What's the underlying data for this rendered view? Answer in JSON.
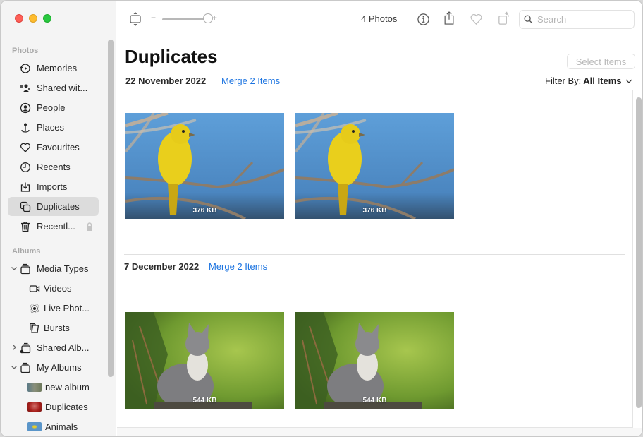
{
  "window": {
    "traffic_lights": [
      "close",
      "minimize",
      "zoom"
    ]
  },
  "sidebar": {
    "sections": [
      {
        "label": "Photos",
        "items": [
          {
            "label": "Memories",
            "icon": "memories-icon"
          },
          {
            "label": "Shared wit...",
            "icon": "shared-with-you-icon"
          },
          {
            "label": "People",
            "icon": "people-icon"
          },
          {
            "label": "Places",
            "icon": "places-icon"
          },
          {
            "label": "Favourites",
            "icon": "heart-icon"
          },
          {
            "label": "Recents",
            "icon": "clock-icon"
          },
          {
            "label": "Imports",
            "icon": "import-icon"
          },
          {
            "label": "Duplicates",
            "icon": "duplicates-icon",
            "selected": true
          },
          {
            "label": "Recentl...",
            "icon": "trash-icon",
            "locked": true
          }
        ]
      },
      {
        "label": "Albums",
        "items": [
          {
            "label": "Media Types",
            "icon": "album-stack-icon",
            "expanded": true
          },
          {
            "label": "Videos",
            "icon": "video-icon"
          },
          {
            "label": "Live Phot...",
            "icon": "live-photo-icon"
          },
          {
            "label": "Bursts",
            "icon": "bursts-icon"
          },
          {
            "label": "Shared Alb...",
            "icon": "shared-album-icon",
            "expanded": false
          },
          {
            "label": "My Albums",
            "icon": "album-stack-icon",
            "expanded": true
          },
          {
            "label": "new album",
            "thumb_color": "#6b7d6a"
          },
          {
            "label": "Duplicates",
            "thumb_color": "#a8201c"
          },
          {
            "label": "Animals",
            "thumb_color": "#5a95c9"
          }
        ]
      }
    ]
  },
  "toolbar": {
    "zoom_minus": "−",
    "zoom_plus": "+",
    "zoom_level": 0.85,
    "photo_count": "4 Photos",
    "search_placeholder": "Search"
  },
  "main": {
    "title": "Duplicates",
    "select_items_label": "Select Items",
    "filter_prefix": "Filter By:",
    "filter_value": "All Items",
    "groups": [
      {
        "date": "22 November 2022",
        "merge_label": "Merge 2 Items",
        "photos": [
          {
            "subject": "yellow bird on branch",
            "size": "376 KB"
          },
          {
            "subject": "yellow bird on branch",
            "size": "376 KB"
          }
        ]
      },
      {
        "date": "7 December 2022",
        "merge_label": "Merge 2 Items",
        "photos": [
          {
            "subject": "kitten in grass",
            "size": "544 KB"
          },
          {
            "subject": "kitten in grass",
            "size": "544 KB"
          }
        ]
      }
    ]
  },
  "colors": {
    "accent": "#1b73e0",
    "selected_bg": "#dcdcdc",
    "sidebar_bg": "#f4f4f4"
  }
}
